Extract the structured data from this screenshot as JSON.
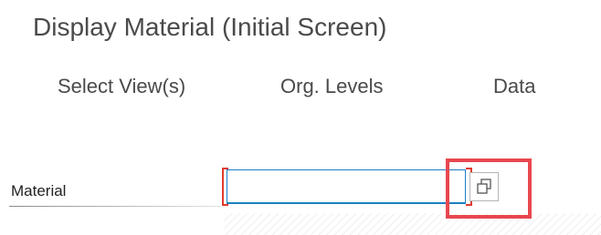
{
  "header": {
    "title": "Display Material (Initial Screen)"
  },
  "toolbar": {
    "select_views": "Select View(s)",
    "org_levels": "Org. Levels",
    "data": "Data"
  },
  "form": {
    "material_label": "Material",
    "material_value": ""
  },
  "icons": {
    "help": "value-help-icon"
  },
  "colors": {
    "accent": "#1b7fc4",
    "highlight": "#e8474f",
    "required_bracket": "#e03a2e"
  }
}
